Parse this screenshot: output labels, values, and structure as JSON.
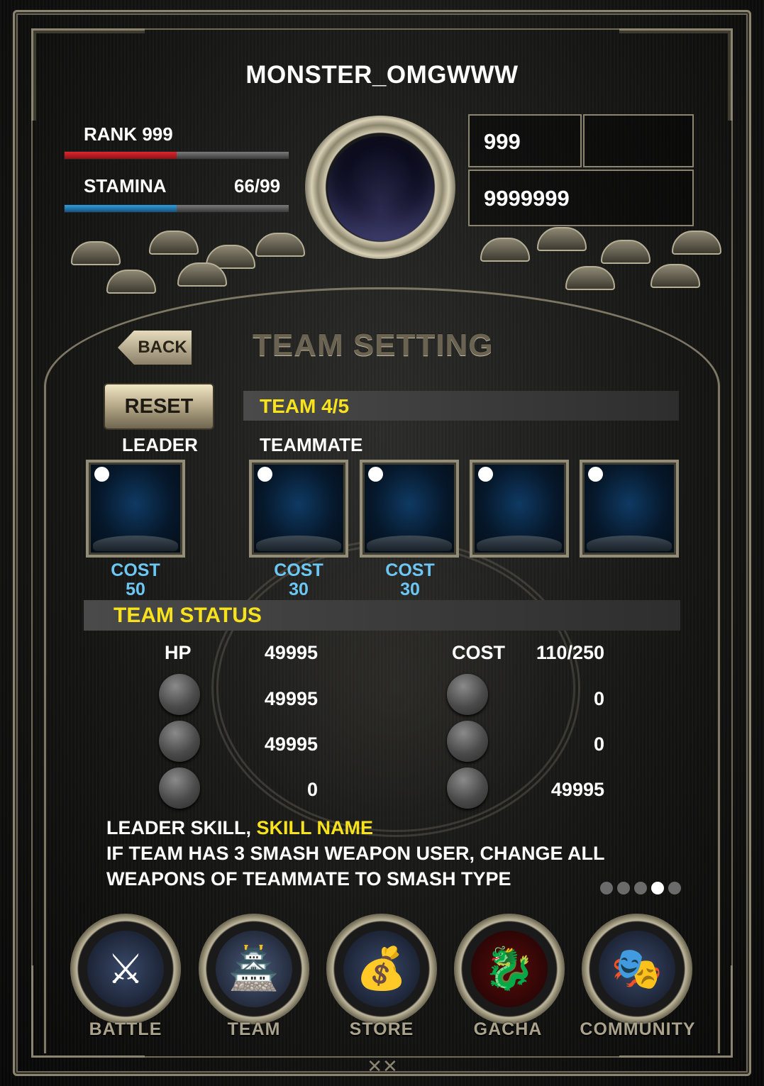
{
  "header": {
    "player_name": "MONSTER_OMGWWW",
    "rank_label": "RANK 999",
    "rank_progress": 0.5,
    "stamina_label": "STAMINA",
    "stamina_value": "66/99",
    "stamina_progress": 0.5,
    "currency_1": "999",
    "currency_2": "",
    "currency_3": "9999999"
  },
  "title_row": {
    "back_label": "BACK",
    "title": "TEAM SETTING",
    "reset_label": "RESET"
  },
  "team": {
    "heading": "TEAM 4/5",
    "leader_label": "LEADER",
    "teammate_label": "TEAMMATE",
    "slots": [
      {
        "cost_label": "COST",
        "cost_value": "50"
      },
      {
        "cost_label": "COST",
        "cost_value": "30"
      },
      {
        "cost_label": "COST",
        "cost_value": "30"
      },
      {
        "cost_label": "",
        "cost_value": ""
      },
      {
        "cost_label": "",
        "cost_value": ""
      }
    ]
  },
  "status": {
    "heading": "TEAM STATUS",
    "hp_label": "HP",
    "hp_value": "49995",
    "cost_label": "COST",
    "cost_value": "110/250",
    "left_values": [
      "49995",
      "49995",
      "0"
    ],
    "right_values": [
      "0",
      "0",
      "49995"
    ]
  },
  "skill": {
    "prefix": "LEADER SKILL, ",
    "name": "SKILL NAME",
    "line1": "IF TEAM HAS 3 SMASH WEAPON USER, CHANGE ALL",
    "line2": "WEAPONS OF TEAMMATE TO SMASH TYPE"
  },
  "pager": {
    "count": 5,
    "active_index": 3
  },
  "nav": {
    "items": [
      {
        "label": "BATTLE",
        "icon": "battle-axe-icon"
      },
      {
        "label": "TEAM",
        "icon": "castle-icon"
      },
      {
        "label": "STORE",
        "icon": "gold-ingot-icon"
      },
      {
        "label": "GACHA",
        "icon": "dragon-icon"
      },
      {
        "label": "COMMUNITY",
        "icon": "masks-icon"
      }
    ]
  },
  "colors": {
    "rank_bar": "#e0262d",
    "stamina_bar": "#2f9ee0",
    "accent_yellow": "#f7e21c",
    "cost_cyan": "#6cc7f4",
    "frame_gold": "#8a8470"
  }
}
